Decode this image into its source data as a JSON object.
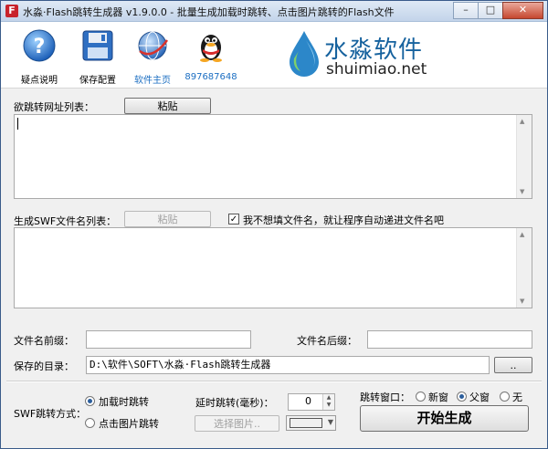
{
  "window": {
    "title": "水淼·Flash跳转生成器 v1.9.0.0 - 批量生成加载时跳转、点击图片跳转的Flash文件",
    "app_icon_letter": "F"
  },
  "toolbar": {
    "items": [
      {
        "label": "疑点说明",
        "icon": "question-icon"
      },
      {
        "label": "保存配置",
        "icon": "floppy-disk-icon"
      },
      {
        "label": "软件主页",
        "icon": "globe-icon"
      },
      {
        "label": "897687648",
        "icon": "qq-penguin-icon"
      }
    ]
  },
  "logo": {
    "brand": "水淼软件",
    "domain": "shuimiao.net"
  },
  "url_list": {
    "label": "欲跳转网址列表：",
    "paste_label": "粘贴",
    "value": ""
  },
  "swf_list": {
    "label": "生成SWF文件名列表：",
    "paste_label": "粘贴",
    "auto_name_checked": true,
    "auto_name_label": "我不想填文件名，就让程序自动递进文件名吧",
    "value": ""
  },
  "prefix": {
    "label": "文件名前缀：",
    "value": ""
  },
  "suffix": {
    "label": "文件名后缀：",
    "value": ""
  },
  "save_dir": {
    "label": "保存的目录：",
    "value": "D:\\软件\\SOFT\\水淼·Flash跳转生成器",
    "browse_label": ".."
  },
  "jump_mode": {
    "label": "SWF跳转方式：",
    "options": [
      {
        "label": "加载时跳转",
        "selected": true
      },
      {
        "label": "点击图片跳转",
        "selected": false
      }
    ]
  },
  "delay": {
    "label": "延时跳转(毫秒)：",
    "value": "0"
  },
  "select_image": {
    "label": "选择图片.."
  },
  "target_window": {
    "label": "跳转窗口：",
    "options": [
      {
        "label": "新窗",
        "selected": false
      },
      {
        "label": "父窗",
        "selected": true
      },
      {
        "label": "无",
        "selected": false
      }
    ]
  },
  "start_button": {
    "label": "开始生成"
  },
  "colors": {
    "accent": "#1b6ec2",
    "title_bar": "#c3d4ea",
    "logo_blue": "#16629e"
  }
}
